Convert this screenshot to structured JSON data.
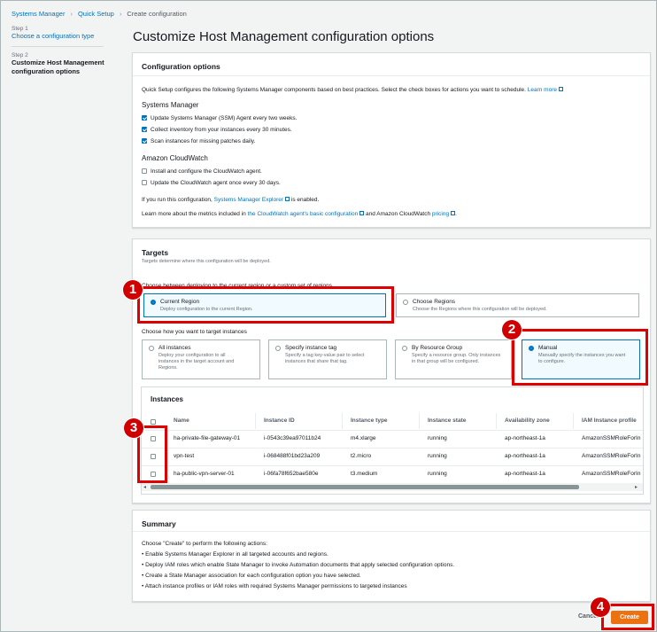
{
  "breadcrumb": [
    "Systems Manager",
    "Quick Setup",
    "Create configuration"
  ],
  "steps": [
    {
      "label": "Step 1",
      "title": "Choose a configuration type"
    },
    {
      "label": "Step 2",
      "title_line1": "Customize Host Management",
      "title_line2": "configuration options"
    }
  ],
  "page_title": "Customize Host Management configuration options",
  "config": {
    "header": "Configuration options",
    "intro": "Quick Setup configures the following Systems Manager components based on best practices. Select the check boxes for actions you want to schedule.",
    "learn_more": "Learn more",
    "ssm_title": "Systems Manager",
    "ssm_items": [
      {
        "label": "Update Systems Manager (SSM) Agent every two weeks.",
        "checked": true
      },
      {
        "label": "Collect inventory from your instances every 30 minutes.",
        "checked": true
      },
      {
        "label": "Scan instances for missing patches daily.",
        "checked": true
      }
    ],
    "cw_title": "Amazon CloudWatch",
    "cw_items": [
      {
        "label": "Install and configure the CloudWatch agent.",
        "checked": false
      },
      {
        "label": "Update the CloudWatch agent once every 30 days.",
        "checked": false
      }
    ],
    "explorer_pre": "If you run this configuration,",
    "explorer_link": "Systems Manager Explorer",
    "explorer_post": "is enabled.",
    "metrics_pre": "Learn more about the metrics included in",
    "metrics_link": "the CloudWatch agent's basic configuration",
    "metrics_mid": "and Amazon CloudWatch",
    "metrics_link2": "pricing",
    "metrics_end": "."
  },
  "targets": {
    "header": "Targets",
    "desc": "Targets determine where this configuration will be deployed.",
    "region_prompt": "Choose between deploying to the current region or a custom set of regions",
    "region_options": [
      {
        "title": "Current Region",
        "desc": "Deploy configuration to the current Region.",
        "selected": true
      },
      {
        "title": "Choose Regions",
        "desc": "Choose the Regions where this configuration will be deployed.",
        "selected": false
      }
    ],
    "instance_prompt": "Choose how you want to target instances",
    "instance_options": [
      {
        "title": "All instances",
        "desc1": "Deploy your configuration to all",
        "desc2": "instances in the target account and",
        "desc3": "Regions.",
        "selected": false
      },
      {
        "title": "Specify instance tag",
        "desc1": "Specify a tag key-value pair to select",
        "desc2": "instances that share that tag.",
        "desc3": "",
        "selected": false
      },
      {
        "title": "By Resource Group",
        "desc1": "Specify a resource group. Only instances",
        "desc2": "in that group will be configured.",
        "desc3": "",
        "selected": false
      },
      {
        "title": "Manual",
        "desc1": "Manually specify the instances you want",
        "desc2": "to configure.",
        "desc3": "",
        "selected": true
      }
    ]
  },
  "instances": {
    "header": "Instances",
    "columns": [
      "Name",
      "Instance ID",
      "Instance type",
      "Instance state",
      "Availability zone",
      "IAM Instance profile"
    ],
    "rows": [
      [
        "ha-private-file-gateway-01",
        "i-0543c39ea97011b24",
        "m4.xlarge",
        "running",
        "ap-northeast-1a",
        "AmazonSSMRoleForIn"
      ],
      [
        "vpn-test",
        "i-068488f01bd23a209",
        "t2.micro",
        "running",
        "ap-northeast-1a",
        "AmazonSSMRoleForIn"
      ],
      [
        "ha-public-vpn-server-01",
        "i-06fa78f652bae580e",
        "t3.medium",
        "running",
        "ap-northeast-1a",
        "AmazonSSMRoleForIn"
      ]
    ]
  },
  "summary": {
    "header": "Summary",
    "intro": "Choose \"Create\" to perform the following actions:",
    "items": [
      "Enable Systems Manager Explorer in all targeted accounts and regions.",
      "Deploy IAM roles which enable State Manager to invoke Automation documents that apply selected configuration options.",
      "Create a State Manager association for each configuration option you have selected.",
      "Attach instance profiles or IAM roles with required Systems Manager permissions to targeted instances"
    ]
  },
  "actions": {
    "cancel": "Cancel",
    "create": "Create"
  },
  "markers": [
    "1",
    "2",
    "3",
    "4"
  ],
  "colors": {
    "accent": "#0073bb",
    "primary_button": "#ec7211",
    "highlight": "#e00000"
  }
}
